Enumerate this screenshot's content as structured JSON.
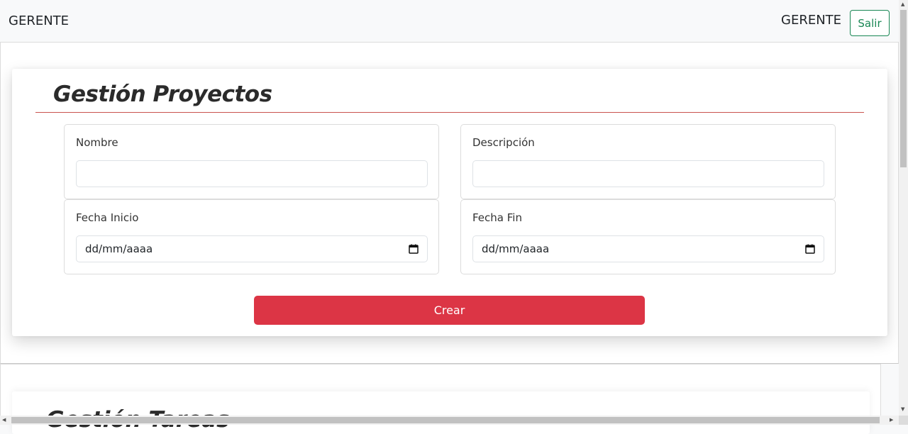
{
  "navbar": {
    "brand": "GERENTE",
    "user": "GERENTE",
    "logout_label": "Salir"
  },
  "projects": {
    "title": "Gestión Proyectos",
    "fields": {
      "name_label": "Nombre",
      "name_value": "",
      "description_label": "Descripción",
      "description_value": "",
      "start_label": "Fecha Inicio",
      "start_placeholder": "dd/mm/aaaa",
      "end_label": "Fecha Fin",
      "end_placeholder": "dd/mm/aaaa"
    },
    "create_label": "Crear"
  },
  "tasks": {
    "title": "Gestión Tareas"
  },
  "colors": {
    "accent_red": "#dc3545",
    "title_line": "#c9534f",
    "logout_green": "#198754"
  },
  "icons": [
    "calendar-icon"
  ]
}
